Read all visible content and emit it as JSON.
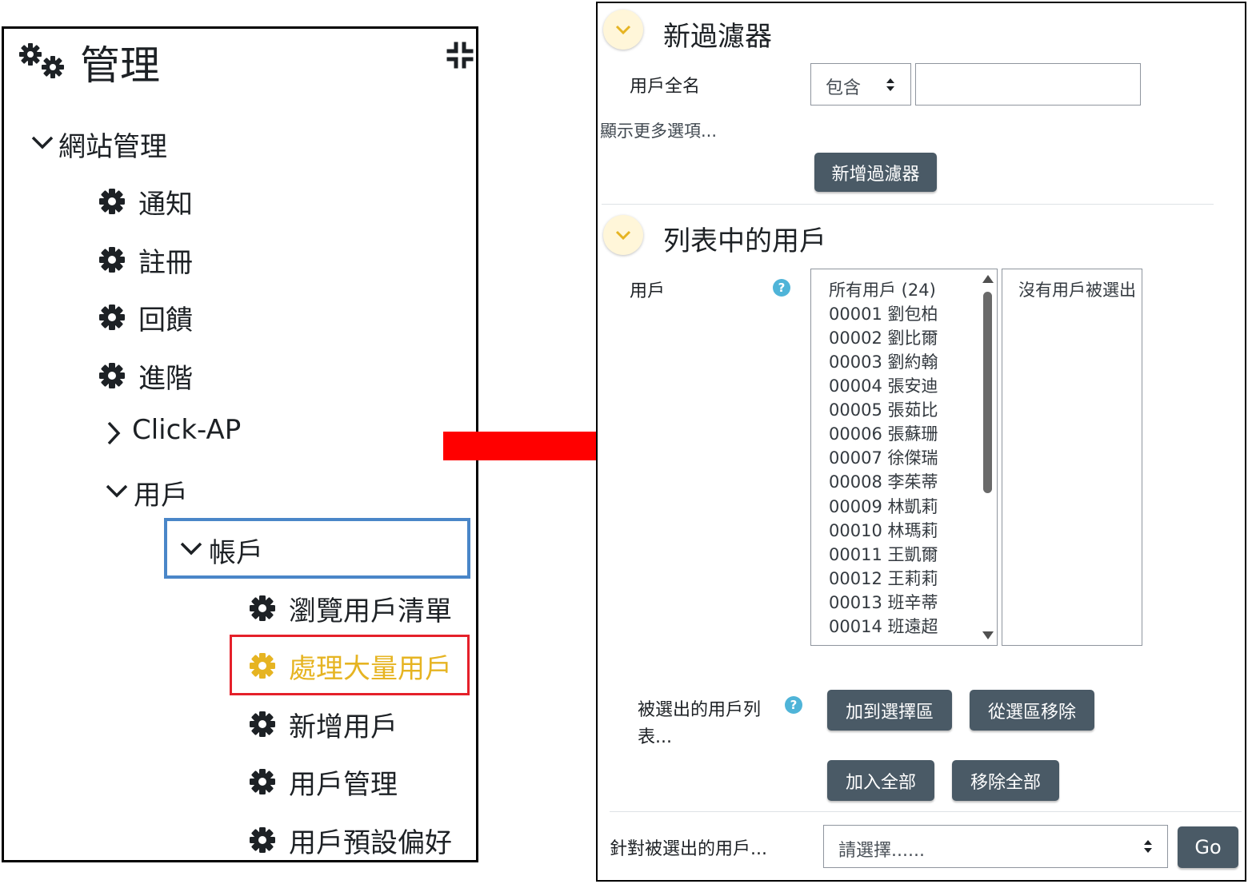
{
  "admin": {
    "title": "管理",
    "site_admin": "網站管理",
    "items": [
      "通知",
      "註冊",
      "回饋",
      "進階"
    ],
    "click_ap": "Click-AP",
    "users": "用戶",
    "accounts": "帳戶",
    "account_items": [
      "瀏覽用戶清單",
      "處理大量用戶",
      "新增用戶",
      "用戶管理",
      "用戶預設偏好"
    ]
  },
  "filter": {
    "title": "新過濾器",
    "fullname_label": "用戶全名",
    "operator": "包含",
    "value": "",
    "more_options": "顯示更多選項...",
    "add_filter": "新增過濾器"
  },
  "users_list": {
    "title": "列表中的用戶",
    "users_label": "用戶",
    "available": [
      "所有用戶 (24)",
      "00001 劉包柏",
      "00002 劉比爾",
      "00003 劉約翰",
      "00004 張安迪",
      "00005 張茹比",
      "00006 張蘇珊",
      "00007 徐傑瑞",
      "00008 李茱蒂",
      "00009 林凱莉",
      "00010 林瑪莉",
      "00011 王凱爾",
      "00012 王莉莉",
      "00013 班辛蒂",
      "00014 班遠超"
    ],
    "selected_empty": "沒有用戶被選出",
    "selected_label_1": "被選出的用戶列",
    "selected_label_2": "表...",
    "add_to_selection": "加到選擇區",
    "remove_from_selection": "從選區移除",
    "add_all": "加入全部",
    "remove_all": "移除全部"
  },
  "bulk": {
    "label": "針對被選出的用戶...",
    "select_placeholder": "請選擇......",
    "go": "Go"
  },
  "colors": {
    "highlight_yellow": "#e6b422",
    "blue_frame": "#4a86c8",
    "red_frame": "#e5202a",
    "arrow_red": "#ff0000",
    "button_gray": "#4a5a66"
  }
}
